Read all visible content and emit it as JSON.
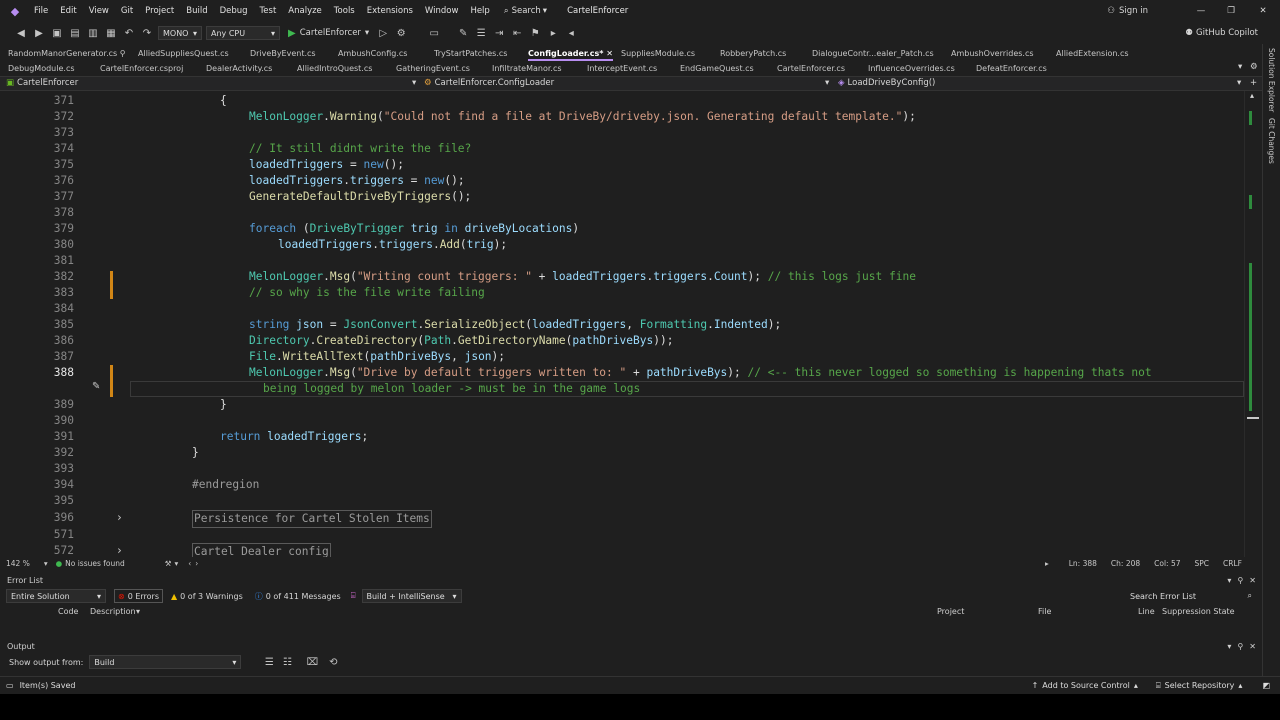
{
  "menu": {
    "items": [
      "File",
      "Edit",
      "View",
      "Git",
      "Project",
      "Build",
      "Debug",
      "Test",
      "Analyze",
      "Tools",
      "Extensions",
      "Window",
      "Help"
    ],
    "search": "Search",
    "solution_title": "CartelEnforcer",
    "sign_in": "Sign in",
    "copilot": "GitHub Copilot"
  },
  "toolbar": {
    "config": "MONO",
    "platform": "Any CPU",
    "run_target": "CartelEnforcer"
  },
  "tabs_row1": [
    {
      "label": "RandomManorGenerator.cs",
      "active": false
    },
    {
      "label": "AlliedSuppliesQuest.cs",
      "active": false
    },
    {
      "label": "DriveByEvent.cs",
      "active": false
    },
    {
      "label": "AmbushConfig.cs",
      "active": false
    },
    {
      "label": "TryStartPatches.cs",
      "active": false
    },
    {
      "label": "ConfigLoader.cs*",
      "active": true
    },
    {
      "label": "SuppliesModule.cs",
      "active": false
    },
    {
      "label": "RobberyPatch.cs",
      "active": false
    },
    {
      "label": "DialogueContr...ealer_Patch.cs",
      "active": false
    },
    {
      "label": "AmbushOverrides.cs",
      "active": false
    },
    {
      "label": "AlliedExtension.cs",
      "active": false
    }
  ],
  "tabs_row2": [
    {
      "label": "DebugModule.cs"
    },
    {
      "label": "CartelEnforcer.csproj"
    },
    {
      "label": "DealerActivity.cs"
    },
    {
      "label": "AlliedIntroQuest.cs"
    },
    {
      "label": "GatheringEvent.cs"
    },
    {
      "label": "InfiltrateManor.cs"
    },
    {
      "label": "InterceptEvent.cs"
    },
    {
      "label": "EndGameQuest.cs"
    },
    {
      "label": "CartelEnforcer.cs"
    },
    {
      "label": "InfluenceOverrides.cs"
    },
    {
      "label": "DefeatEnforcer.cs"
    }
  ],
  "navbar": {
    "project": "CartelEnforcer",
    "class": "CartelEnforcer.ConfigLoader",
    "member": "LoadDriveByConfig()"
  },
  "code": {
    "current_line": "388",
    "lines": [
      {
        "n": "371",
        "t": "{"
      },
      {
        "n": "372",
        "t": "MelonLogger.Warning(\"Could not find a file at DriveBy/driveby.json. Generating default template.\");"
      },
      {
        "n": "373",
        "t": ""
      },
      {
        "n": "374",
        "t": "// It still didnt write the file?"
      },
      {
        "n": "375",
        "t": "loadedTriggers = new();"
      },
      {
        "n": "376",
        "t": "loadedTriggers.triggers = new();"
      },
      {
        "n": "377",
        "t": "GenerateDefaultDriveByTriggers();"
      },
      {
        "n": "378",
        "t": ""
      },
      {
        "n": "379",
        "t": "foreach (DriveByTrigger trig in driveByLocations)"
      },
      {
        "n": "380",
        "t": "loadedTriggers.triggers.Add(trig);"
      },
      {
        "n": "381",
        "t": ""
      },
      {
        "n": "382",
        "t": "MelonLogger.Msg(\"Writing count triggers: \" + loadedTriggers.triggers.Count); // this logs just fine"
      },
      {
        "n": "383",
        "t": "// so why is the file write failing"
      },
      {
        "n": "384",
        "t": ""
      },
      {
        "n": "385",
        "t": "string json = JsonConvert.SerializeObject(loadedTriggers, Formatting.Indented);"
      },
      {
        "n": "386",
        "t": "Directory.CreateDirectory(Path.GetDirectoryName(pathDriveBys));"
      },
      {
        "n": "387",
        "t": "File.WriteAllText(pathDriveBys, json);"
      },
      {
        "n": "388",
        "t": "MelonLogger.Msg(\"Drive by default triggers written to: \" + pathDriveBys); // <-- this never logged so something is happening thats not"
      },
      {
        "n": "",
        "t": "being logged by melon loader -> must be in the game logs"
      },
      {
        "n": "389",
        "t": "}"
      },
      {
        "n": "390",
        "t": ""
      },
      {
        "n": "391",
        "t": "return loadedTriggers;"
      },
      {
        "n": "392",
        "t": "}"
      },
      {
        "n": "393",
        "t": ""
      },
      {
        "n": "394",
        "t": "#endregion"
      },
      {
        "n": "395",
        "t": ""
      },
      {
        "n": "396",
        "t": "Persistence for Cartel Stolen Items"
      },
      {
        "n": "571",
        "t": ""
      },
      {
        "n": "572",
        "t": "Cartel Dealer config"
      }
    ]
  },
  "editor_status": {
    "zoom": "142 %",
    "issues": "No issues found",
    "ln": "Ln: 388",
    "ch": "Ch: 208",
    "col": "Col: 57",
    "spc": "SPC",
    "crlf": "CRLF"
  },
  "error_list": {
    "title": "Error List",
    "scope": "Entire Solution",
    "errors": "0 Errors",
    "warnings": "0 of 3 Warnings",
    "messages": "0 of 411 Messages",
    "build_filter": "Build + IntelliSense",
    "search": "Search Error List",
    "columns": [
      "Code",
      "Description",
      "Project",
      "File",
      "Line",
      "Suppression State"
    ]
  },
  "output": {
    "title": "Output",
    "show_from_label": "Show output from:",
    "source": "Build"
  },
  "status": {
    "saved": "Item(s) Saved",
    "source_control": "Add to Source Control",
    "repository": "Select Repository"
  },
  "side": {
    "solution_explorer": "Solution Explorer",
    "git_changes": "Git Changes"
  },
  "colors": {
    "accent": "#007acc",
    "error": "#e51400",
    "warning": "#f0c000",
    "info": "#3794ff",
    "change_mark": "#2e8b3d"
  }
}
